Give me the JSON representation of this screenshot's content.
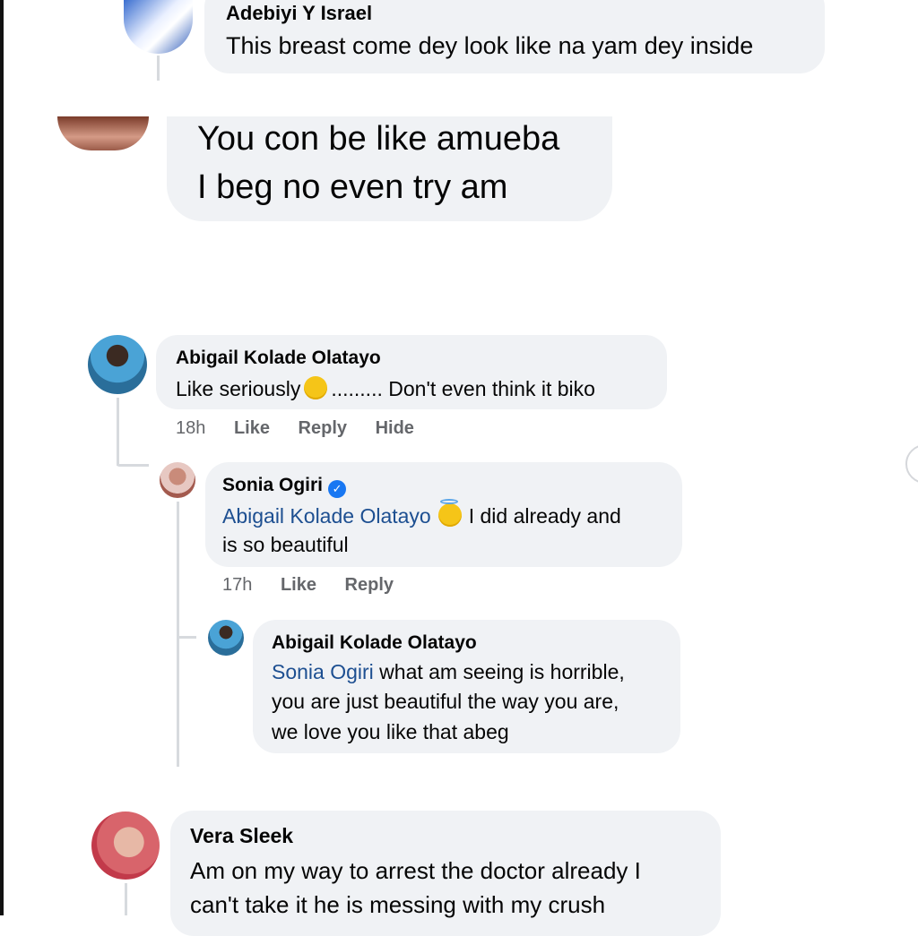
{
  "comments": [
    {
      "name": "Adebiyi Y Israel",
      "text": "This breast come dey look like na yam dey inside"
    },
    {
      "line1": "You con be like amueba",
      "line2": "I beg no even try am"
    },
    {
      "name": "Abigail Kolade Olatayo",
      "text_before": "Like seriously",
      "emoji": "tears-of-joy",
      "text_after": "......... Don't even think it biko",
      "time": "18h",
      "like": "Like",
      "reply": "Reply",
      "hide": "Hide"
    },
    {
      "name": "Sonia Ogiri",
      "mention": "Abigail Kolade Olatayo",
      "emoji": "smiling-face-with-halo",
      "text_line1": "I did already and",
      "text_line2": "is so beautiful",
      "time": "17h",
      "like": "Like",
      "reply": "Reply"
    },
    {
      "name": "Abigail Kolade Olatayo",
      "mention": "Sonia Ogiri",
      "text_line1": "what am seeing is horrible,",
      "text_line2": "you are just beautiful the way you are,",
      "text_line3": "we love you like that abeg"
    },
    {
      "name": "Vera Sleek",
      "text_line1": "Am on my way to arrest the doctor already I",
      "text_line2": "can't take it he is messing with my crush"
    }
  ],
  "colors": {
    "bubble": "#f0f2f5",
    "mention": "#1d4f91",
    "meta": "#65676b",
    "verified": "#1877f2"
  }
}
